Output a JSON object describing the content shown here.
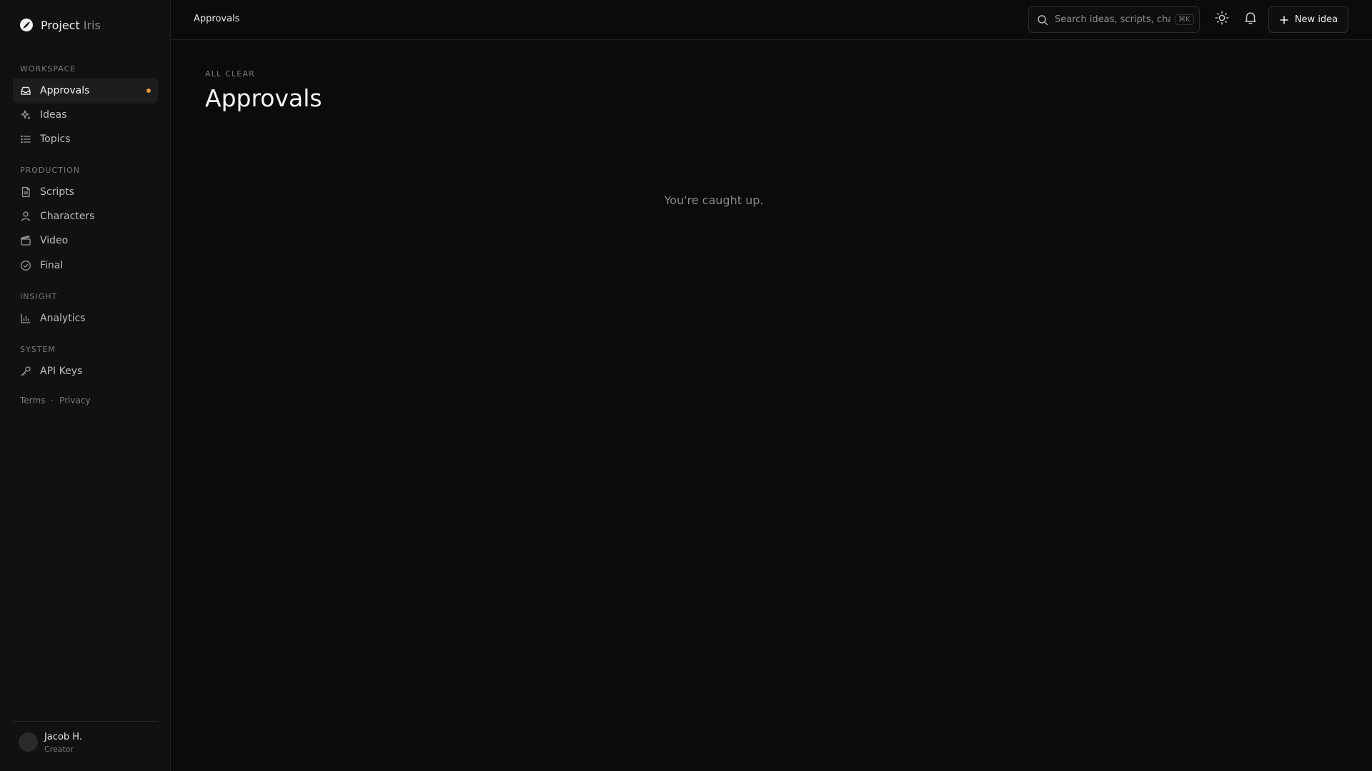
{
  "brand": {
    "name": "Project",
    "sub": "Iris"
  },
  "sidebar": {
    "sections": [
      {
        "label": "WORKSPACE"
      },
      {
        "label": "PRODUCTION"
      },
      {
        "label": "INSIGHT"
      },
      {
        "label": "SYSTEM"
      }
    ],
    "items": [
      {
        "label": "Approvals",
        "icon": "inbox-icon",
        "active": true,
        "has_dot": true
      },
      {
        "label": "Ideas",
        "icon": "sparkle-icon"
      },
      {
        "label": "Topics",
        "icon": "list-icon"
      },
      {
        "label": "Scripts",
        "icon": "document-icon"
      },
      {
        "label": "Characters",
        "icon": "user-icon"
      },
      {
        "label": "Video",
        "icon": "clapperboard-icon"
      },
      {
        "label": "Final",
        "icon": "check-circle-icon"
      },
      {
        "label": "Analytics",
        "icon": "bar-chart-icon"
      },
      {
        "label": "API Keys",
        "icon": "key-icon"
      }
    ],
    "footer": {
      "terms": "Terms",
      "separator": "·",
      "privacy": "Privacy"
    },
    "user": {
      "name": "Jacob H.",
      "role": "Creator"
    }
  },
  "header": {
    "breadcrumb": "Approvals",
    "search": {
      "placeholder": "Search ideas, scripts, characters…",
      "shortcut": "⌘K"
    },
    "new_button_label": "New idea"
  },
  "main": {
    "eyebrow": "ALL CLEAR",
    "title": "Approvals",
    "empty_message": "You're caught up."
  },
  "colors": {
    "background": "#0b0b0b",
    "sidebar": "#111111",
    "accent_dot": "#e8963f"
  }
}
